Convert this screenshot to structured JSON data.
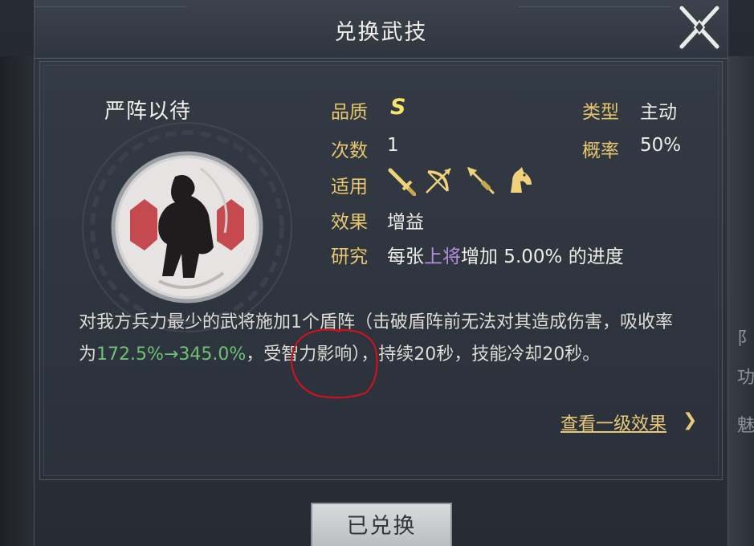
{
  "dialog": {
    "title": "兑换武技"
  },
  "skill": {
    "name": "严阵以待"
  },
  "info": {
    "quality_label": "品质",
    "quality_value": "S",
    "count_label": "次数",
    "count_value": "1",
    "type_label": "类型",
    "type_value": "主动",
    "rate_label": "概率",
    "rate_value": "50%",
    "applies_label": "适用",
    "applies_icons": [
      "sword-icon",
      "bow-icon",
      "spear-icon",
      "horse-icon"
    ],
    "effect_label": "效果",
    "effect_value": "增益",
    "research_label": "研究",
    "research_prefix": "每张",
    "research_highlight": "上将",
    "research_suffix": "增加 5.00% 的进度"
  },
  "description": {
    "part1": "对我方兵力最少的武将施加1个盾阵（击破盾阵前无法对其造成伤害，吸收率为",
    "value_from": "172.5%",
    "arrow": "→",
    "value_to": "345.0%",
    "part2": "，受智力影响），持续20秒，技能冷却20秒。"
  },
  "links": {
    "see_level1": "查看一级效果",
    "see_arrow": "❯"
  },
  "buttons": {
    "exchanged": "已兑换"
  },
  "background": {
    "right_glyphs": [
      "阝",
      "功",
      "魅"
    ]
  },
  "colors": {
    "label_gold": "#e7c66e",
    "value_green": "#6cc374",
    "highlight_purple": "#b68ce0",
    "grade_yellow": "#f6e56a"
  }
}
